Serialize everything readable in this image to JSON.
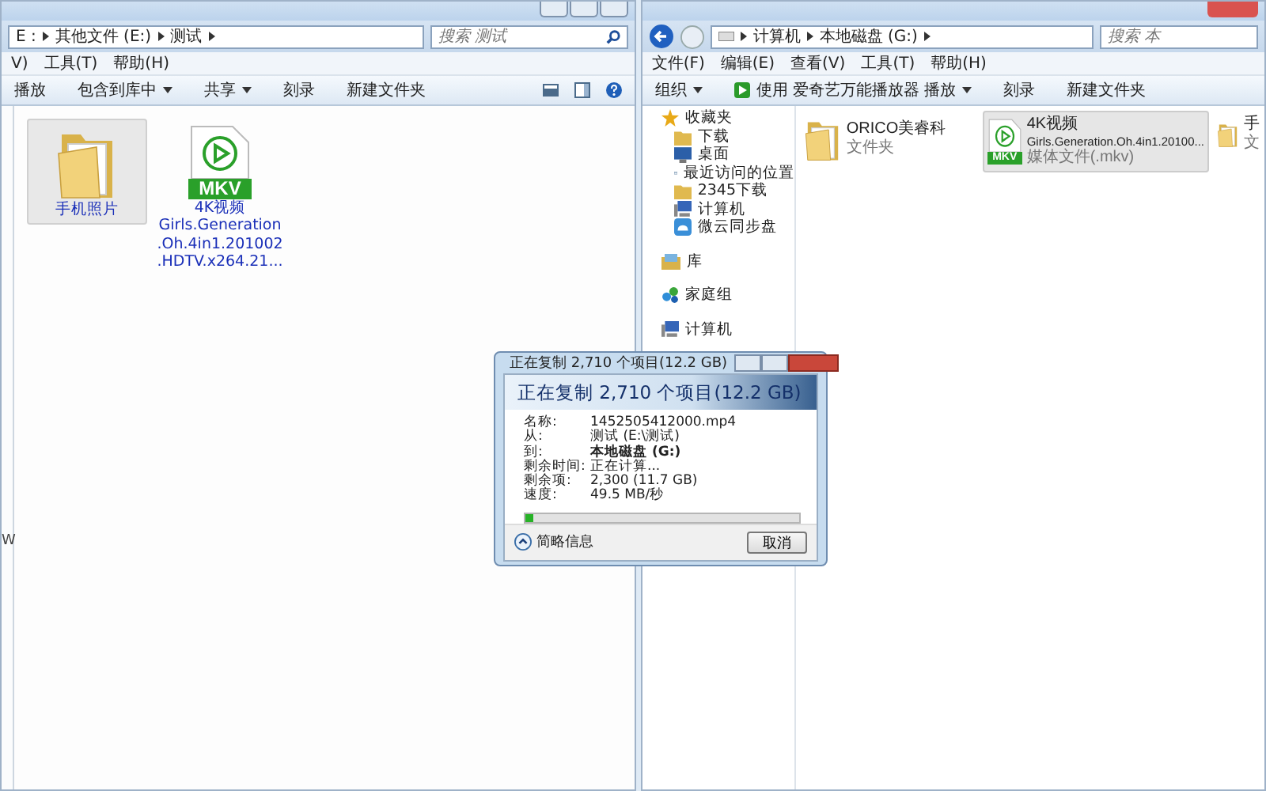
{
  "left_window": {
    "address": [
      "E :",
      "其他文件 (E:)",
      "测试"
    ],
    "search": {
      "placeholder": "搜索 测试"
    },
    "menu": [
      "V)",
      "工具(T)",
      "帮助(H)"
    ],
    "toolbar": [
      {
        "label": "播放",
        "dropdown": false
      },
      {
        "label": "包含到库中",
        "dropdown": true
      },
      {
        "label": "共享",
        "dropdown": true
      },
      {
        "label": "刻录",
        "dropdown": false
      },
      {
        "label": "新建文件夹",
        "dropdown": false
      }
    ],
    "sidebar_fragment": "W",
    "items": [
      {
        "kind": "folder",
        "lines": [
          "手机照片"
        ],
        "selected": true
      },
      {
        "kind": "video",
        "badge": "MKV",
        "lines": [
          "4K视频",
          "Girls.Generation",
          ".Oh.4in1.201002",
          ".HDTV.x264.21..."
        ],
        "selected": false
      }
    ]
  },
  "right_window": {
    "address": [
      "计算机",
      "本地磁盘 (G:)"
    ],
    "search": {
      "placeholder": "搜索 本"
    },
    "menu": [
      "文件(F)",
      "编辑(E)",
      "查看(V)",
      "工具(T)",
      "帮助(H)"
    ],
    "toolbar": [
      {
        "label": "组织",
        "dropdown": true,
        "kind": "plain"
      },
      {
        "label": "使用 爱奇艺万能播放器 播放",
        "dropdown": true,
        "kind": "play"
      },
      {
        "label": "刻录",
        "dropdown": false,
        "kind": "plain"
      },
      {
        "label": "新建文件夹",
        "dropdown": false,
        "kind": "plain"
      }
    ],
    "sidebar": [
      {
        "label": "收藏夹",
        "kind": "star",
        "children": [
          {
            "label": "下载",
            "kind": "folder"
          },
          {
            "label": "桌面",
            "kind": "desktop"
          },
          {
            "label": "最近访问的位置",
            "kind": "recent"
          },
          {
            "label": "2345下载",
            "kind": "folder"
          },
          {
            "label": "计算机",
            "kind": "computer"
          },
          {
            "label": "微云同步盘",
            "kind": "cloud"
          }
        ]
      },
      {
        "label": "库",
        "kind": "library"
      },
      {
        "label": "家庭组",
        "kind": "homegroup"
      },
      {
        "label": "计算机",
        "kind": "computer"
      }
    ],
    "items": [
      {
        "kind": "folder",
        "name": "ORICO美睿科",
        "type": "文件夹",
        "selected": false
      },
      {
        "kind": "video",
        "badge": "MKV",
        "name": "4K视频",
        "detail": "Girls.Generation.Oh.4in1.20100...",
        "type": "媒体文件(.mkv)",
        "selected": true
      },
      {
        "kind": "folder",
        "name": "手",
        "type": "文",
        "selected": false
      }
    ]
  },
  "dialog": {
    "title": "正在复制 2,710 个项目(12.2 GB)",
    "heading": "正在复制 2,710 个项目(12.2 GB)",
    "rows": [
      {
        "label": "名称:",
        "value": "1452505412000.mp4",
        "bold": false
      },
      {
        "label": "从:",
        "value": "测试 (E:\\测试)",
        "bold": false
      },
      {
        "label": "到:",
        "value": "本地磁盘 (G:)",
        "bold": true
      },
      {
        "label": "剩余时间:",
        "value": "正在计算...",
        "bold": false
      },
      {
        "label": "剩余项:",
        "value": "2,300 (11.7 GB)",
        "bold": false
      },
      {
        "label": "速度:",
        "value": "49.5 MB/秒",
        "bold": false
      }
    ],
    "progress": {
      "level": 0.03
    },
    "details_toggle": "简略信息",
    "cancel": "取消"
  }
}
